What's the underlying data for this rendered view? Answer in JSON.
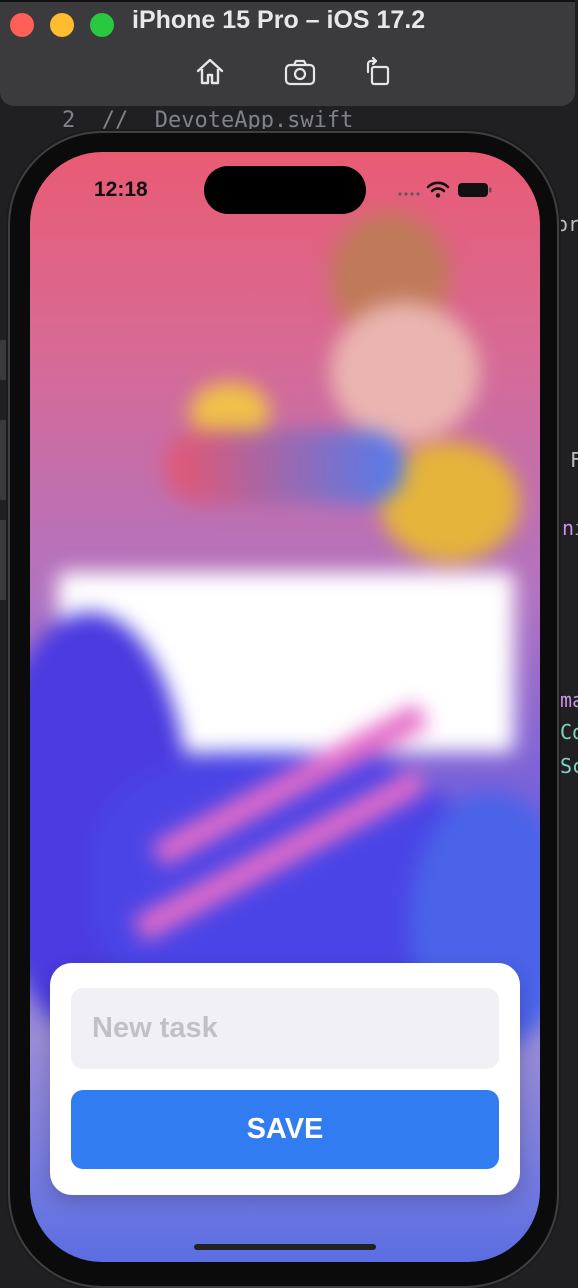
{
  "simulator": {
    "title": "iPhone 15 Pro – iOS 17.2",
    "toolbar": [
      {
        "name": "home-icon"
      },
      {
        "name": "screenshot-icon"
      },
      {
        "name": "rotate-icon"
      }
    ]
  },
  "editor": {
    "line_number": "2",
    "line_text": "//  DevoteApp.swift",
    "fragments": [
      "or",
      "F",
      "ni",
      "ma",
      "Co",
      "Sc"
    ]
  },
  "status_bar": {
    "time": "12:18"
  },
  "new_task_sheet": {
    "input_value": "",
    "input_placeholder": "New task",
    "save_label": "SAVE"
  },
  "colors": {
    "save_button": "#317cf0",
    "input_background": "#f1f1f5",
    "sheet_background": "#ffffff"
  }
}
